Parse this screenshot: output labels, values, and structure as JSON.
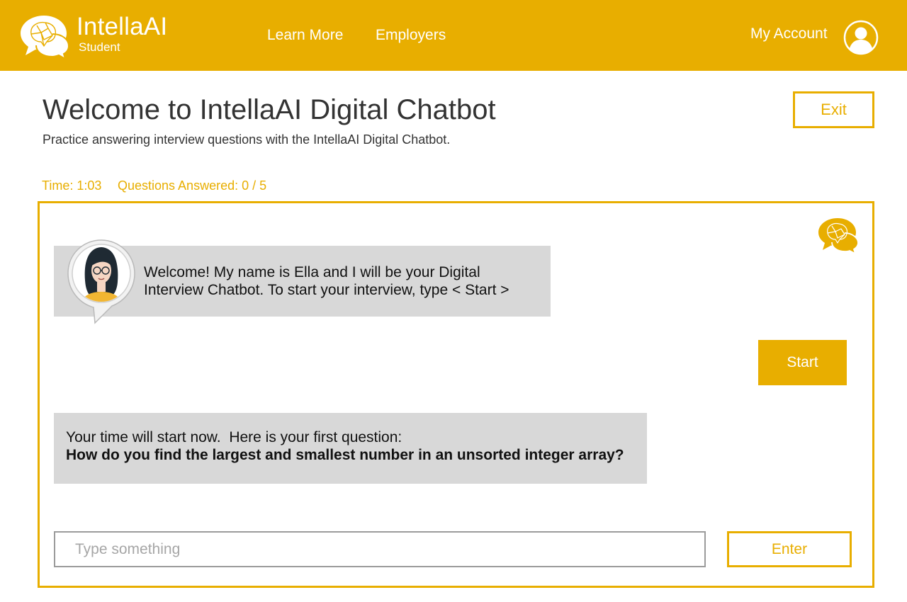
{
  "colors": {
    "brand": "#E8AE00",
    "bubble": "#D8D8D8",
    "text": "#333333"
  },
  "header": {
    "brand_name": "IntellaAI",
    "brand_sub": "Student",
    "nav": {
      "learn_more": "Learn More",
      "employers": "Employers"
    },
    "account_label": "My Account",
    "icons": {
      "logo": "brain-chat-logo-icon",
      "account": "user-avatar-icon"
    }
  },
  "main": {
    "title": "Welcome to IntellaAI Digital Chatbot",
    "subtitle": "Practice answering interview questions with the IntellaAI Digital Chatbot.",
    "exit_label": "Exit",
    "status": {
      "time": "Time: 1:03",
      "questions": "Questions Answered: 0 / 5"
    }
  },
  "chat": {
    "bot_greeting": "Welcome! My name is Ella and I will be your Digital Interview Chatbot. To start your interview, type < Start >",
    "user_reply": "Start",
    "bot_intro": "Your time will start now.  Here is your first question:",
    "bot_question": "How do you find the largest and smallest number in an unsorted integer array?",
    "input_placeholder": "Type something",
    "enter_label": "Enter",
    "icons": {
      "bot_avatar": "bot-avatar-icon",
      "frame_logo": "brain-chat-logo-icon"
    }
  }
}
